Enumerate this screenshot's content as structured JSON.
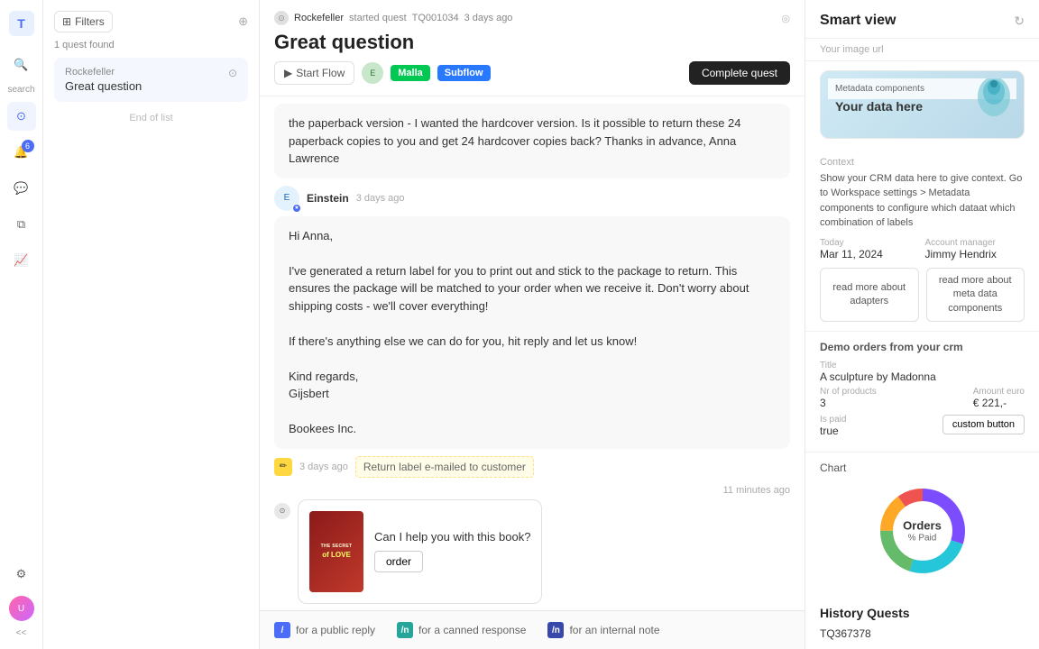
{
  "app": {
    "logo": "T"
  },
  "left_nav": {
    "items": [
      {
        "id": "search",
        "label": "search",
        "icon": "🔍",
        "badge": null,
        "sub": "search"
      },
      {
        "id": "inbox",
        "label": "inbox",
        "icon": "⊙",
        "badge": null
      },
      {
        "id": "notifications",
        "label": "notifications",
        "icon": "🔔",
        "badge": "6"
      },
      {
        "id": "messages",
        "label": "messages",
        "icon": "💬",
        "badge": null
      },
      {
        "id": "copies",
        "label": "copies",
        "icon": "⧉",
        "badge": null
      },
      {
        "id": "analytics",
        "label": "analytics",
        "icon": "📈",
        "badge": null
      },
      {
        "id": "settings",
        "label": "settings",
        "icon": "⚙",
        "badge": null
      }
    ],
    "user_initials": "U",
    "collapse_label": "<<"
  },
  "sidebar": {
    "filters_label": "Filters",
    "quest_count": "1 quest found",
    "quest": {
      "name": "Rockefeller",
      "title": "Great question"
    },
    "end_of_list": "End of list"
  },
  "main": {
    "quest_meta": {
      "actor": "Rockefeller",
      "action": "started quest",
      "quest_id": "TQ001034",
      "time": "3 days ago"
    },
    "quest_title": "Great question",
    "actions": {
      "start_flow": "Start Flow",
      "tag1": "Malla",
      "tag2": "Subflow",
      "complete": "Complete quest"
    },
    "messages": [
      {
        "type": "text",
        "text": "the paperback version - I wanted the hardcover version. Is it possible to return these 24 paperback copies to you and get 24 hardcover copies back? Thanks in advance, Anna Lawrence"
      },
      {
        "type": "agent",
        "name": "Einstein",
        "time": "3 days ago",
        "avatar_text": "E",
        "is_bot": true,
        "body": "Hi Anna,\n\nI've generated a return label for you to print out and stick to the package to return. This ensures the package will be matched to your order when we receive it. Don't worry about shipping costs - we'll cover everything!\n\nIf there's anything else we can do for you, hit reply and let us know!\n\nKind regards,\nGijsbert\n\nBookees Inc."
      },
      {
        "type": "internal_note",
        "time": "3 days ago",
        "text": "Return label e-mailed to customer"
      },
      {
        "type": "book_card",
        "time": "11 minutes ago",
        "book_title_top": "THE SECRET",
        "book_subtitle": "of LOVE",
        "question": "Can I help you with this book?",
        "order_btn": "order"
      }
    ],
    "reply_bar": {
      "option1_prefix": "/",
      "option1_text": "for a public reply",
      "option2_prefix": "/n",
      "option2_text": "for a canned response",
      "option3_prefix": "/n",
      "option3_text": "for an internal note"
    }
  },
  "smart_panel": {
    "title": "Smart view",
    "url_placeholder": "Your image url",
    "preview": {
      "label": "Metadata components",
      "title": "Your data here"
    },
    "context": {
      "label": "Context",
      "description": "Show your CRM data here to give context. Go to Workspace settings > Metadata components to configure which dataat which combination of labels",
      "today_label": "Today",
      "today_value": "Mar 11, 2024",
      "account_manager_label": "Account manager",
      "account_manager_value": "Jimmy Hendrix",
      "btn1_line1": "read more about",
      "btn1_line2": "adapters",
      "btn2_line1": "read more about",
      "btn2_line2": "meta data components"
    },
    "orders": {
      "section_label": "Demo orders from your crm",
      "title_label": "Title",
      "title_value": "A sculpture by Madonna",
      "nr_products_label": "Nr of products",
      "nr_products_value": "3",
      "amount_label": "Amount euro",
      "amount_value": "€ 221,-",
      "is_paid_label": "Is paid",
      "is_paid_value": "true",
      "custom_btn": "custom button"
    },
    "chart": {
      "label": "Chart",
      "donut_label": "Orders",
      "donut_sub": "% Paid",
      "segments": [
        {
          "color": "#7c4dff",
          "percent": 30
        },
        {
          "color": "#26c6da",
          "percent": 25
        },
        {
          "color": "#66bb6a",
          "percent": 20
        },
        {
          "color": "#ffa726",
          "percent": 15
        },
        {
          "color": "#ef5350",
          "percent": 10
        }
      ]
    },
    "history": {
      "title": "History Quests",
      "id_placeholder": "TQ367378"
    }
  }
}
